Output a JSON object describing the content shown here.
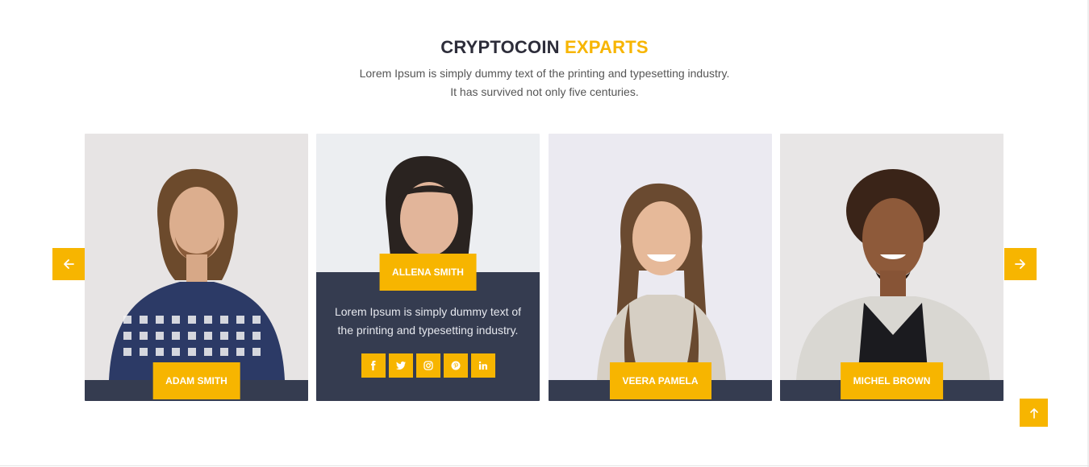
{
  "section": {
    "title_dark": "CRYPTOCOIN",
    "title_accent": "EXPARTS",
    "subtitle_line1": "Lorem Ipsum is simply dummy text of the printing and typesetting industry.",
    "subtitle_line2": "It has survived not only five centuries."
  },
  "experts": [
    {
      "name": "ADAM SMITH"
    },
    {
      "name": "ALLENA SMITH",
      "bio": "Lorem Ipsum is simply dummy text of the printing and typesetting industry.",
      "socials": [
        "facebook-icon",
        "twitter-icon",
        "instagram-icon",
        "pinterest-icon",
        "linkedin-icon"
      ]
    },
    {
      "name": "VEERA PAMELA"
    },
    {
      "name": "MICHEL BROWN"
    }
  ],
  "colors": {
    "accent": "#f7b500",
    "navy": "#353c50",
    "heading": "#2d2d3a"
  },
  "icons": {
    "prev": "arrow-left-icon",
    "next": "arrow-right-icon",
    "scroll_top": "arrow-up-icon"
  }
}
